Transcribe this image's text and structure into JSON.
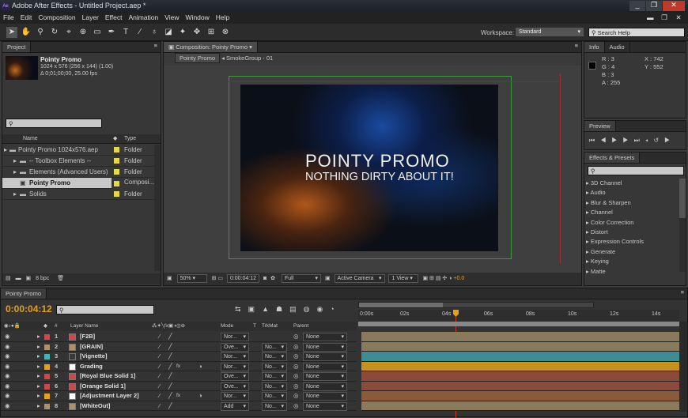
{
  "window": {
    "title": "Adobe After Effects - Untitled Project.aep *"
  },
  "menu": [
    "File",
    "Edit",
    "Composition",
    "Layer",
    "Effect",
    "Animation",
    "View",
    "Window",
    "Help"
  ],
  "toolbar": {
    "workspace_label": "Workspace:",
    "workspace_value": "Standard",
    "search_placeholder": "Search Help"
  },
  "project": {
    "tab": "Project",
    "comp_name": "Pointy Promo",
    "meta1": "1024 x 576  (256 x 144) (1.00)",
    "meta2": "Δ 0;01;00;00, 25.00 fps",
    "columns": [
      "Name",
      "Type"
    ],
    "items": [
      {
        "name": "Pointy Promo 1024x576.aep",
        "type": "Folder",
        "color": "#e6d84a"
      },
      {
        "name": "-- Toolbox Elements --",
        "type": "Folder",
        "color": "#e6d84a"
      },
      {
        "name": "Elements (Advanced Users)",
        "type": "Folder",
        "color": "#e6d84a"
      },
      {
        "name": "Pointy Promo",
        "type": "Composi...",
        "color": "#e6d84a"
      },
      {
        "name": "Solids",
        "type": "Folder",
        "color": "#e6d84a"
      }
    ],
    "bpc": "8 bpc"
  },
  "composition": {
    "tab": "Composition: Pointy Promo",
    "crumb1": "Pointy Promo",
    "crumb2": "SmokeGroup - 01",
    "title_line1": "POINTY PROMO",
    "title_line2": "NOTHING DIRTY ABOUT IT!",
    "zoom": "50%",
    "timecode": "0:00:04:12",
    "resolution": "Full",
    "camera": "Active Camera",
    "view": "1 View",
    "exposure": "+0.0"
  },
  "info": {
    "tabs": [
      "Info",
      "Audio"
    ],
    "r": "R : 3",
    "g": "G : 4",
    "b": "B : 3",
    "a": "A : 255",
    "x": "X : 742",
    "y": "Y : 552"
  },
  "preview": {
    "tab": "Preview"
  },
  "effects": {
    "tab": "Effects & Presets",
    "categories": [
      "3D Channel",
      "Audio",
      "Blur & Sharpen",
      "Channel",
      "Color Correction",
      "Distort",
      "Expression Controls",
      "Generate",
      "Keying",
      "Matte"
    ]
  },
  "timeline": {
    "tab": "Pointy Promo",
    "timecode": "0:00:04:12",
    "headers": {
      "num": "#",
      "layer": "Layer Name",
      "mode": "Mode",
      "t": "T",
      "trkmat": "TrkMat",
      "parent": "Parent"
    },
    "ruler": [
      "0:00s",
      "02s",
      "04s",
      "06s",
      "08s",
      "10s",
      "12s",
      "14s"
    ],
    "layers": [
      {
        "num": "1",
        "name": "[F2B]",
        "label": "#c84a4a",
        "mode": "Nor...",
        "trkmat": "",
        "parent": "None",
        "bar": "#8a7a5c",
        "fx": false
      },
      {
        "num": "2",
        "name": "[GRAIN]",
        "label": "#b0906a",
        "mode": "Ove...",
        "trkmat": "No...",
        "parent": "None",
        "bar": "#8a7a5c",
        "fx": false
      },
      {
        "num": "3",
        "name": "[Vignette]",
        "label": "#4ab0b8",
        "mode": "Nor...",
        "trkmat": "No...",
        "parent": "None",
        "bar": "#3e8c94",
        "fx": false
      },
      {
        "num": "4",
        "name": "Grading",
        "label": "#e6a020",
        "mode": "Nor...",
        "trkmat": "No...",
        "parent": "None",
        "bar": "#c8901c",
        "fx": true
      },
      {
        "num": "5",
        "name": "[Royal Blue Solid 1]",
        "label": "#c84a4a",
        "mode": "Ove...",
        "trkmat": "No...",
        "parent": "None",
        "bar": "#8c4a3a",
        "fx": false
      },
      {
        "num": "6",
        "name": "[Orange Solid 1]",
        "label": "#c84a4a",
        "mode": "Ove...",
        "trkmat": "No...",
        "parent": "None",
        "bar": "#8c4a3a",
        "fx": false
      },
      {
        "num": "7",
        "name": "[Adjustment Layer 2]",
        "label": "#e6a020",
        "mode": "Nor...",
        "trkmat": "No...",
        "parent": "None",
        "bar": "#8a5a3a",
        "fx": true
      },
      {
        "num": "8",
        "name": "[WhiteOut]",
        "label": "#b0906a",
        "mode": "Add",
        "trkmat": "No...",
        "parent": "None",
        "bar": "#8a7a5c",
        "fx": false
      }
    ]
  }
}
